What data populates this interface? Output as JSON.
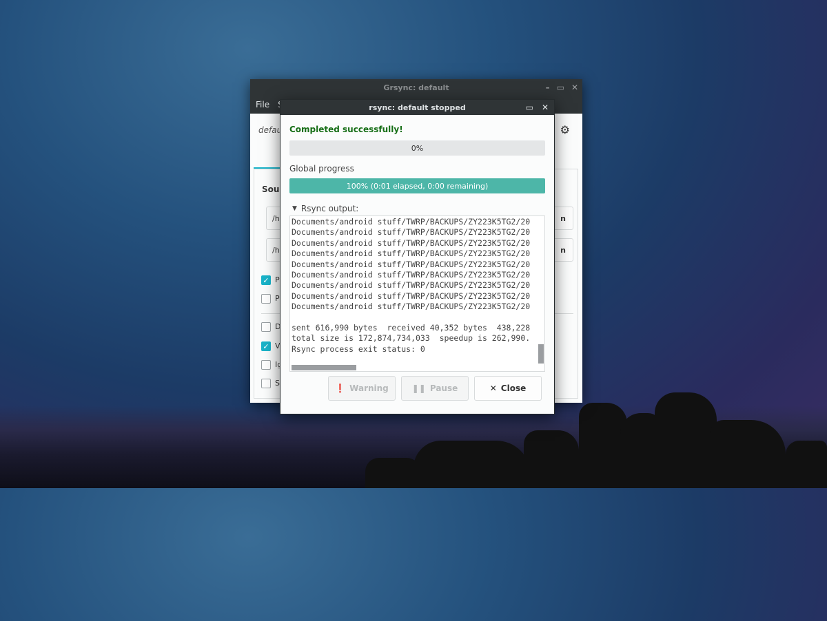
{
  "main_window": {
    "title": "Grsync: default",
    "menu": [
      "File",
      "S"
    ],
    "profile": "defau",
    "sources_label": "Sour",
    "source_path": "/h",
    "dest_path": "/h",
    "path_button": "n",
    "options": [
      {
        "label": "P",
        "checked": true
      },
      {
        "label": "P",
        "checked": false
      },
      {
        "label": "D",
        "checked": false
      },
      {
        "label": "V",
        "checked": true
      },
      {
        "label": "Ig",
        "checked": false
      },
      {
        "label": "Sl",
        "checked": false
      }
    ]
  },
  "dialog": {
    "title": "rsync: default stopped",
    "status": "Completed successfully!",
    "file_progress": {
      "text": "0%",
      "value": 0
    },
    "global_label": "Global progress",
    "global_progress": {
      "text": "100% (0:01 elapsed, 0:00 remaining)",
      "value": 100
    },
    "output_label": "Rsync output:",
    "output_text": "Documents/android stuff/TWRP/BACKUPS/ZY223K5TG2/20\nDocuments/android stuff/TWRP/BACKUPS/ZY223K5TG2/20\nDocuments/android stuff/TWRP/BACKUPS/ZY223K5TG2/20\nDocuments/android stuff/TWRP/BACKUPS/ZY223K5TG2/20\nDocuments/android stuff/TWRP/BACKUPS/ZY223K5TG2/20\nDocuments/android stuff/TWRP/BACKUPS/ZY223K5TG2/20\nDocuments/android stuff/TWRP/BACKUPS/ZY223K5TG2/20\nDocuments/android stuff/TWRP/BACKUPS/ZY223K5TG2/20\nDocuments/android stuff/TWRP/BACKUPS/ZY223K5TG2/20\n\nsent 616,990 bytes  received 40,352 bytes  438,228\ntotal size is 172,874,734,033  speedup is 262,990.\nRsync process exit status: 0",
    "buttons": {
      "warning": "Warning",
      "pause": "Pause",
      "close": "Close"
    }
  },
  "colors": {
    "accent": "#19b3c9",
    "progress_fill": "#4db6a8",
    "success_text": "#166e16",
    "titlebar": "#2f3436"
  },
  "icons": {
    "warning": "exclamation-circle-icon",
    "pause": "pause-icon",
    "close": "x-icon",
    "gear": "gear-icon"
  }
}
